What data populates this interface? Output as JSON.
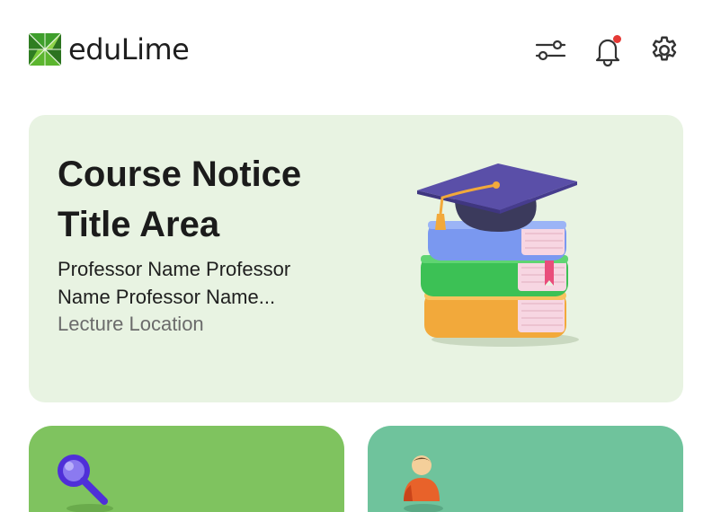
{
  "app": {
    "name": "eduLime"
  },
  "header": {
    "icons": [
      "sliders-icon",
      "bell-icon",
      "gear-icon"
    ],
    "has_notification": true
  },
  "notice": {
    "title": "Course Notice Title Area",
    "professor": "Professor Name Professor Name Professor Name...",
    "location": "Lecture Location"
  },
  "tiles": [
    {
      "icon": "magnifier-icon"
    },
    {
      "icon": "person-icon"
    }
  ],
  "colors": {
    "brand_dark": "#1f5f1f",
    "brand_light": "#6bbf2a",
    "hero_bg": "#e8f3e2",
    "tile_green": "#7fc35f",
    "tile_teal": "#6fc39c",
    "notification": "#e53935"
  }
}
